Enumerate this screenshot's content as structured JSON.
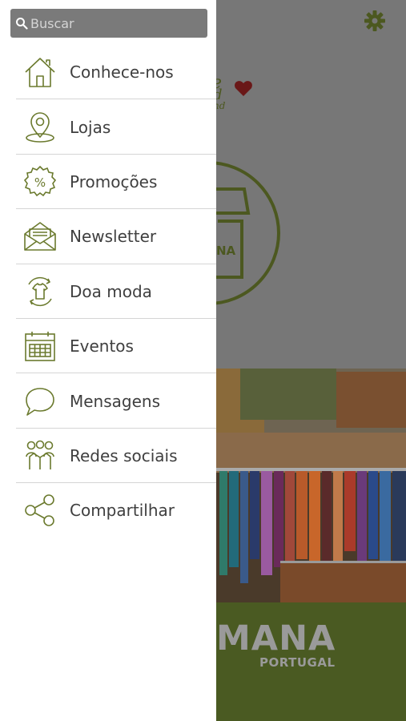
{
  "colors": {
    "accent": "#6b7a2e",
    "overlay": "#777777"
  },
  "search": {
    "placeholder": "Buscar"
  },
  "menu": {
    "items": [
      {
        "label": "Conhece-nos",
        "icon": "home-icon"
      },
      {
        "label": "Lojas",
        "icon": "location-pin-icon"
      },
      {
        "label": "Promoções",
        "icon": "discount-badge-icon"
      },
      {
        "label": "Newsletter",
        "icon": "envelope-icon"
      },
      {
        "label": "Doa moda",
        "icon": "tshirt-recycle-icon"
      },
      {
        "label": "Eventos",
        "icon": "calendar-icon"
      },
      {
        "label": "Mensagens",
        "icon": "chat-bubble-icon"
      },
      {
        "label": "Redes sociais",
        "icon": "people-icon"
      },
      {
        "label": "Compartilhar",
        "icon": "share-icon"
      }
    ]
  },
  "background": {
    "logo_script": [
      "e",
      "d",
      "nd"
    ],
    "store_badge_text": "NA",
    "brand_name": "MANA",
    "brand_country": "PORTUGAL"
  }
}
